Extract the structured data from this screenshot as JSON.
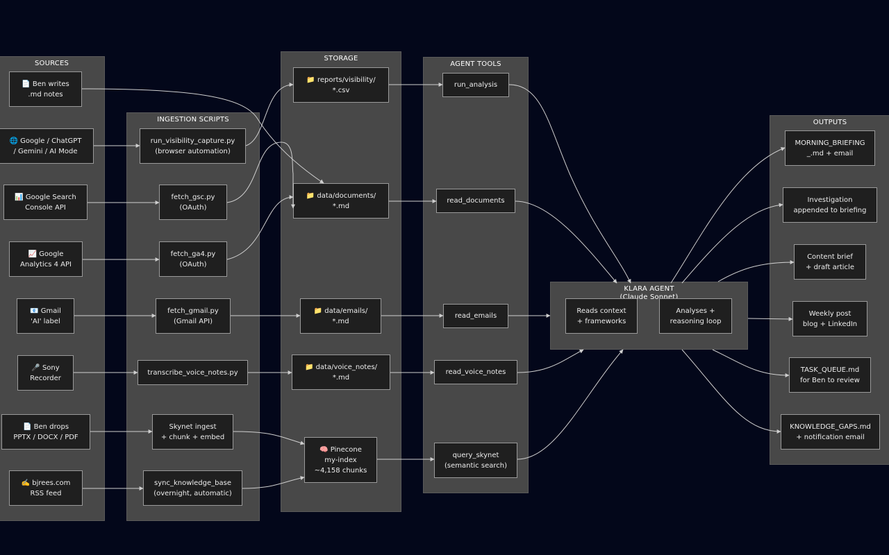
{
  "clusters": {
    "sources": "SOURCES",
    "ingestion": "INGESTION SCRIPTS",
    "storage": "STORAGE",
    "tools": "AGENT TOOLS",
    "agent": "KLARA AGENT",
    "outputs": "OUTPUTS"
  },
  "agent_subtitle": "(Claude Sonnet)",
  "nodes": {
    "src_ben_notes": [
      "📄 Ben writes",
      ".md notes"
    ],
    "src_google_ai": [
      "🌐 Google / ChatGPT",
      "/ Gemini / AI Mode"
    ],
    "src_gsc": [
      "📊 Google Search",
      "Console API"
    ],
    "src_ga4": [
      "📈 Google",
      "Analytics 4 API"
    ],
    "src_gmail": [
      "📧 Gmail",
      "'AI' label"
    ],
    "src_sony": [
      "🎤 Sony",
      "Recorder"
    ],
    "src_ben_drops": [
      "📄 Ben drops",
      "PPTX / DOCX / PDF"
    ],
    "src_rss": [
      "✍️ bjrees.com",
      "RSS feed"
    ],
    "ing_visibility": [
      "run_visibility_capture.py",
      "(browser automation)"
    ],
    "ing_gsc": [
      "fetch_gsc.py",
      "(OAuth)"
    ],
    "ing_ga4": [
      "fetch_ga4.py",
      "(OAuth)"
    ],
    "ing_gmail": [
      "fetch_gmail.py",
      "(Gmail API)"
    ],
    "ing_voice": [
      "transcribe_voice_notes.py"
    ],
    "ing_skynet": [
      "Skynet ingest",
      "+ chunk + embed"
    ],
    "ing_sync": [
      "sync_knowledge_base",
      "(overnight, automatic)"
    ],
    "st_visibility": [
      "📁 reports/visibility/",
      "*.csv"
    ],
    "st_documents": [
      "📁 data/documents/",
      "*.md"
    ],
    "st_emails": [
      "📁 data/emails/",
      "*.md"
    ],
    "st_voice": [
      "📁 data/voice_notes/",
      "*.md"
    ],
    "st_pinecone": [
      "🧠 Pinecone",
      "my-index",
      "~4,158 chunks"
    ],
    "tool_analysis": [
      "run_analysis"
    ],
    "tool_documents": [
      "read_documents"
    ],
    "tool_emails": [
      "read_emails"
    ],
    "tool_voice": [
      "read_voice_notes"
    ],
    "tool_skynet": [
      "query_skynet",
      "(semantic search)"
    ],
    "ag_reads": [
      "Reads context",
      "+ frameworks"
    ],
    "ag_analyses": [
      "Analyses +",
      "reasoning loop"
    ],
    "out_briefing": [
      "MORNING_BRIEFING",
      "_.md + email"
    ],
    "out_investigation": [
      "Investigation",
      "appended to briefing"
    ],
    "out_content": [
      "Content brief",
      "+ draft article"
    ],
    "out_weekly": [
      "Weekly post",
      "blog + LinkedIn"
    ],
    "out_task": [
      "TASK_QUEUE.md",
      "for Ben to review"
    ],
    "out_gaps": [
      "KNOWLEDGE_GAPS.md",
      "+ notification email"
    ]
  },
  "colors": {
    "background": "#03071a",
    "cluster": "#484848",
    "node_fill": "#1f1f1f",
    "node_border": "#9a9a9a",
    "edge": "#cfcfcf"
  }
}
